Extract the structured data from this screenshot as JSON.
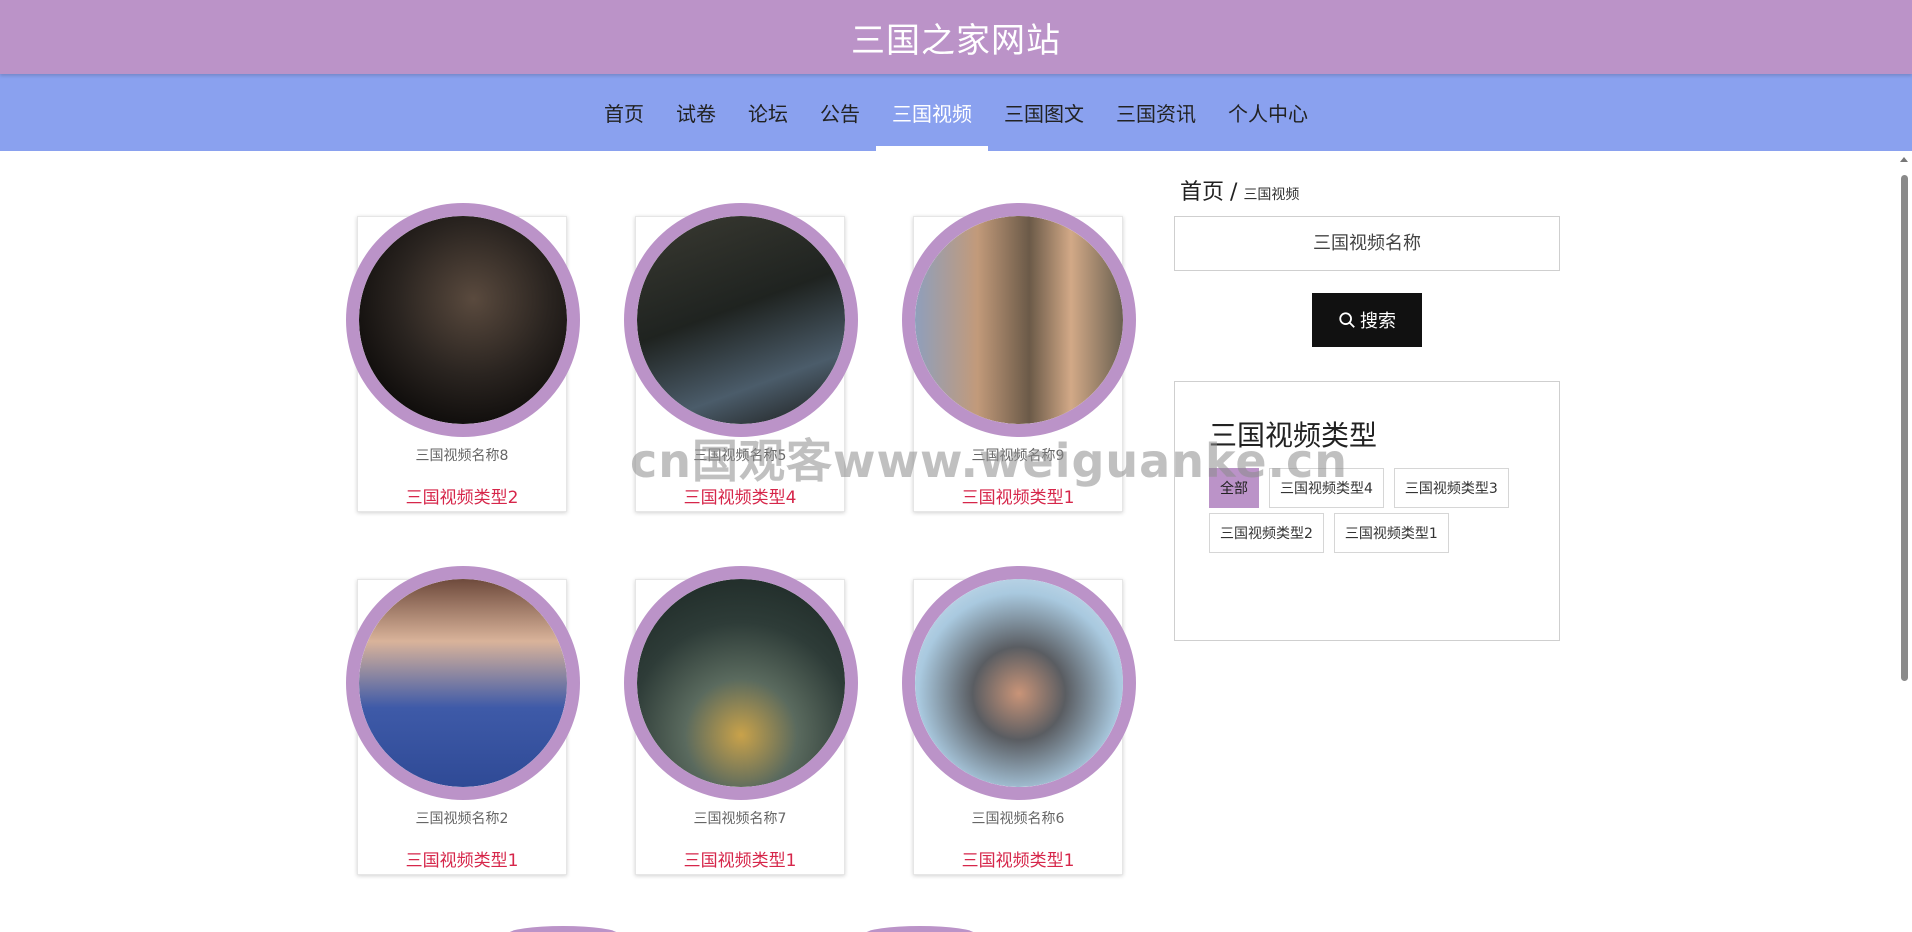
{
  "header": {
    "title": "三国之家网站"
  },
  "nav": {
    "items": [
      {
        "label": "首页"
      },
      {
        "label": "试卷"
      },
      {
        "label": "论坛"
      },
      {
        "label": "公告"
      },
      {
        "label": "三国视频",
        "active": true
      },
      {
        "label": "三国图文"
      },
      {
        "label": "三国资讯"
      },
      {
        "label": "个人中心"
      }
    ]
  },
  "cards": [
    {
      "name": "三国视频名称8",
      "type": "三国视频类型2"
    },
    {
      "name": "三国视频名称5",
      "type": "三国视频类型4"
    },
    {
      "name": "三国视频名称9",
      "type": "三国视频类型1"
    },
    {
      "name": "三国视频名称2",
      "type": "三国视频类型1"
    },
    {
      "name": "三国视频名称7",
      "type": "三国视频类型1"
    },
    {
      "name": "三国视频名称6",
      "type": "三国视频类型1"
    }
  ],
  "breadcrumb": {
    "home": "首页",
    "separator": "/",
    "current": "三国视频"
  },
  "search": {
    "placeholder": "三国视频名称",
    "value": "",
    "button_label": "搜索"
  },
  "type_panel": {
    "title": "三国视频类型",
    "tags": [
      {
        "label": "全部",
        "active": true
      },
      {
        "label": "三国视频类型4"
      },
      {
        "label": "三国视频类型3"
      },
      {
        "label": "三国视频类型2"
      },
      {
        "label": "三国视频类型1"
      }
    ]
  },
  "watermark": "cn国观客www.weiguanke.cn",
  "colors": {
    "header_bg": "#bb93c8",
    "nav_bg": "#8aa1ef",
    "accent": "#bb93c8",
    "type_text": "#d6264a"
  }
}
